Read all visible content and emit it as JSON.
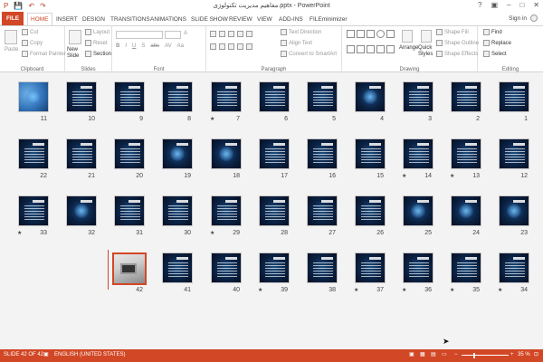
{
  "window": {
    "title": "مفاهیم مدیریت تکنولوژی.pptx - PowerPoint",
    "controls": [
      "?",
      "▣",
      "–",
      "□",
      "✕"
    ]
  },
  "qat": [
    "P",
    "💾",
    "↶",
    "↷"
  ],
  "tabs": [
    "FILE",
    "HOME",
    "INSERT",
    "DESIGN",
    "TRANSITIONS",
    "ANIMATIONS",
    "SLIDE SHOW",
    "REVIEW",
    "VIEW",
    "ADD-INS",
    "FILEminimizer"
  ],
  "active_tab": "HOME",
  "signin": "Sign in",
  "ribbon": {
    "clipboard": {
      "label": "Clipboard",
      "paste": "Paste",
      "cut": "Cut",
      "copy": "Copy",
      "format_painter": "Format Painter"
    },
    "slides": {
      "label": "Slides",
      "new_slide": "New Slide",
      "layout": "Layout",
      "reset": "Reset",
      "section": "Section"
    },
    "font": {
      "label": "Font",
      "buttons": [
        "B",
        "I",
        "U",
        "S",
        "abc",
        "AV",
        "Aa",
        "A"
      ]
    },
    "paragraph": {
      "label": "Paragraph",
      "text_direction": "Text Direction",
      "align_text": "Align Text",
      "convert": "Convert to SmartArt"
    },
    "drawing": {
      "label": "Drawing",
      "arrange": "Arrange",
      "quick_styles": "Quick Styles",
      "shape_fill": "Shape Fill",
      "shape_outline": "Shape Outline",
      "shape_effects": "Shape Effects"
    },
    "editing": {
      "label": "Editing",
      "find": "Find",
      "replace": "Replace",
      "select": "Select"
    }
  },
  "slides": [
    {
      "num": "1",
      "star": false
    },
    {
      "num": "2",
      "star": false
    },
    {
      "num": "3",
      "star": false
    },
    {
      "num": "4",
      "star": false
    },
    {
      "num": "5",
      "star": false
    },
    {
      "num": "6",
      "star": false
    },
    {
      "num": "7",
      "star": true
    },
    {
      "num": "8",
      "star": false
    },
    {
      "num": "9",
      "star": false
    },
    {
      "num": "10",
      "star": false
    },
    {
      "num": "11",
      "star": false
    },
    {
      "num": "12",
      "star": false
    },
    {
      "num": "13",
      "star": true
    },
    {
      "num": "14",
      "star": true
    },
    {
      "num": "15",
      "star": false
    },
    {
      "num": "16",
      "star": false
    },
    {
      "num": "17",
      "star": false
    },
    {
      "num": "18",
      "star": false
    },
    {
      "num": "19",
      "star": false
    },
    {
      "num": "20",
      "star": false
    },
    {
      "num": "21",
      "star": false
    },
    {
      "num": "22",
      "star": false
    },
    {
      "num": "23",
      "star": false
    },
    {
      "num": "24",
      "star": false
    },
    {
      "num": "25",
      "star": false
    },
    {
      "num": "26",
      "star": false
    },
    {
      "num": "27",
      "star": false
    },
    {
      "num": "28",
      "star": false
    },
    {
      "num": "29",
      "star": true
    },
    {
      "num": "30",
      "star": false
    },
    {
      "num": "31",
      "star": false
    },
    {
      "num": "32",
      "star": false
    },
    {
      "num": "33",
      "star": true
    },
    {
      "num": "34",
      "star": true
    },
    {
      "num": "35",
      "star": true
    },
    {
      "num": "36",
      "star": true
    },
    {
      "num": "37",
      "star": true
    },
    {
      "num": "38",
      "star": false
    },
    {
      "num": "39",
      "star": true
    },
    {
      "num": "40",
      "star": false
    },
    {
      "num": "41",
      "star": false
    },
    {
      "num": "42",
      "star": false
    }
  ],
  "status": {
    "slide_info": "SLIDE 42 OF 42",
    "language": "ENGLISH (UNITED STATES)",
    "zoom": "35 %",
    "zoom_minus": "−",
    "zoom_plus": "+"
  },
  "colors": {
    "accent": "#d24726",
    "slide_bg": "#0b2244"
  }
}
